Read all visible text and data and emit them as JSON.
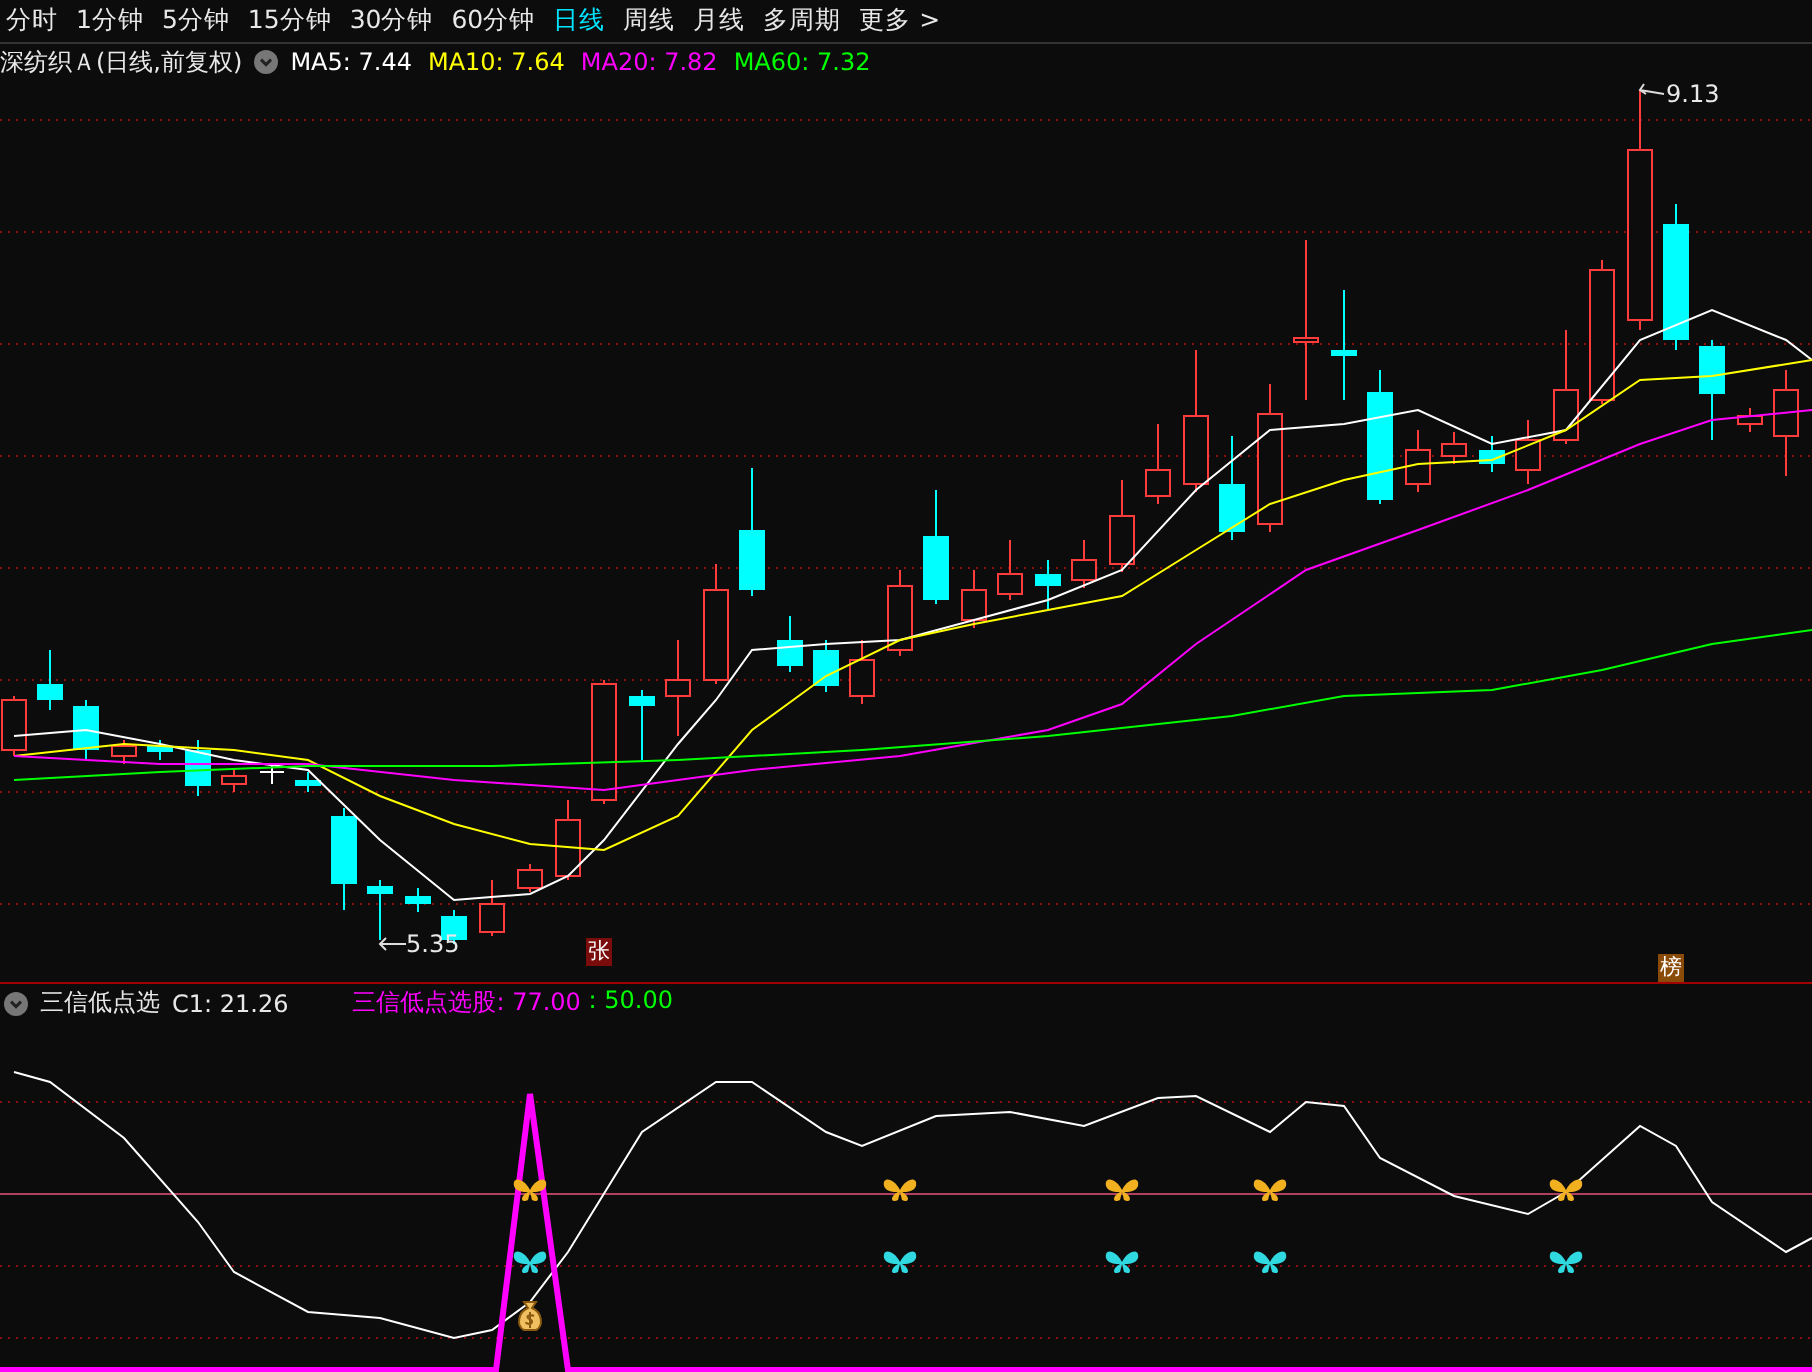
{
  "tabs": [
    {
      "label": "分时",
      "selected": false
    },
    {
      "label": "1分钟",
      "selected": false
    },
    {
      "label": "5分钟",
      "selected": false
    },
    {
      "label": "15分钟",
      "selected": false
    },
    {
      "label": "30分钟",
      "selected": false
    },
    {
      "label": "60分钟",
      "selected": false
    },
    {
      "label": "日线",
      "selected": true
    },
    {
      "label": "周线",
      "selected": false
    },
    {
      "label": "月线",
      "selected": false
    },
    {
      "label": "多周期",
      "selected": false
    },
    {
      "label": "更多 >",
      "selected": false
    }
  ],
  "main_chart": {
    "title": "深纺织Ａ(日线,前复权)",
    "ma_legend": [
      {
        "label": "MA5: 7.44",
        "color": "#ffffff"
      },
      {
        "label": "MA10: 7.64",
        "color": "#ffff00"
      },
      {
        "label": "MA20: 7.82",
        "color": "#ff00ff"
      },
      {
        "label": "MA60: 7.32",
        "color": "#00ff00"
      }
    ],
    "high_label": "9.13",
    "low_label": "5.35",
    "markers": [
      {
        "text": "张",
        "color": "#7a0c0c"
      },
      {
        "text": "榜",
        "color": "#8a4a08"
      }
    ]
  },
  "indicator": {
    "name": "三信低点选",
    "c1": "C1: 21.26",
    "series": [
      {
        "label": "三信低点选股: 77.00",
        "color": "#ff00ff"
      },
      {
        "label": " : 50.00",
        "color": "#00ff00"
      }
    ]
  }
}
